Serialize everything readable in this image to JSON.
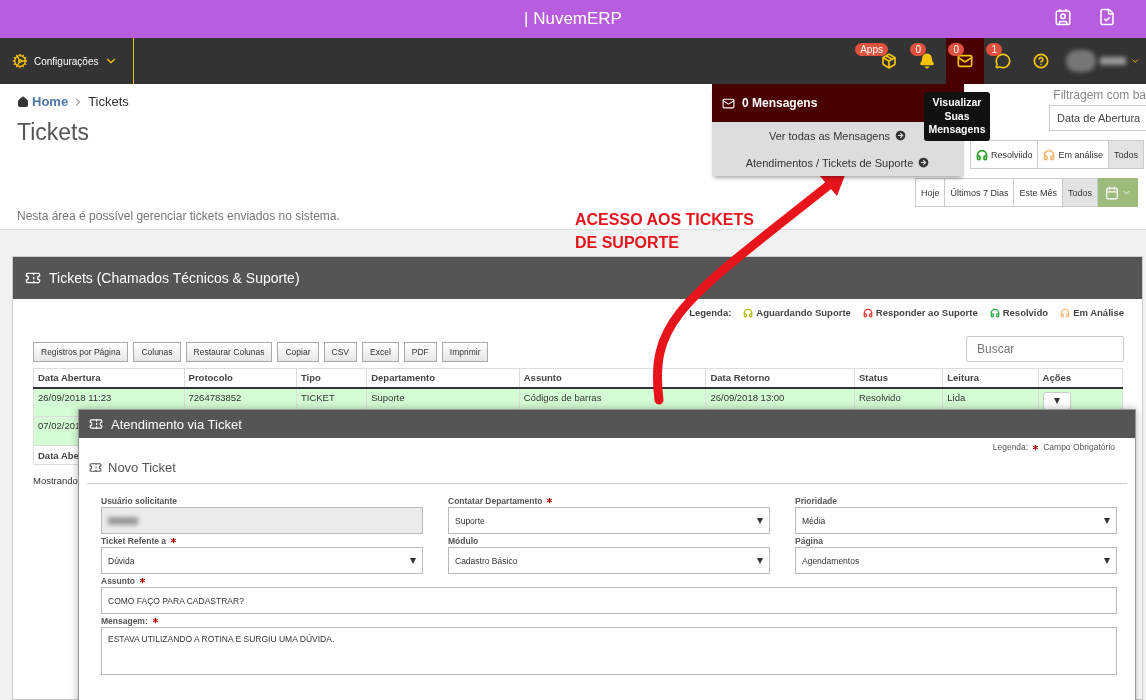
{
  "title_bar": {
    "title": "| NuvemERP"
  },
  "nav": {
    "menu": "Configurações",
    "items": [
      {
        "kind": "apps",
        "badge": "Apps",
        "selected": false
      },
      {
        "kind": "bell",
        "badge": "0",
        "selected": false
      },
      {
        "kind": "mail",
        "badge": "0",
        "selected": true
      },
      {
        "kind": "chat",
        "badge": "1",
        "selected": false
      },
      {
        "kind": "help",
        "selected": false
      },
      {
        "kind": "user",
        "selected": false
      }
    ]
  },
  "messages_menu": {
    "header": "0 Mensagens",
    "items": [
      "Ver todas as Mensagens",
      "Atendimentos / Tickets de Suporte"
    ]
  },
  "tooltip": "Visualizar Suas Mensagens",
  "breadcrumb": [
    "Home",
    "Tickets"
  ],
  "page_title": "Tickets",
  "description": "Nesta área é possível gerenciar tickets enviados no sistema.",
  "filter": {
    "label": "Filtragem com ba",
    "date_field": "Data de Abertura",
    "status_buttons": [
      {
        "label": "Resolviido",
        "color": "#2ca02c",
        "selected": false
      },
      {
        "label": "Em análise",
        "color": "#f5b971",
        "selected": false
      },
      {
        "label": "Todos",
        "selected": true
      }
    ],
    "period_buttons": [
      {
        "label": "Hoje",
        "selected": false
      },
      {
        "label": "Últimos 7 Dias",
        "selected": false
      },
      {
        "label": "Este Mês",
        "selected": false
      },
      {
        "label": "Todos",
        "selected": true
      }
    ]
  },
  "annotation": "ACESSO AOS TICKETS DE SUPORTE",
  "panel": {
    "title": "Tickets (Chamados Técnicos & Suporte)",
    "legend_label": "Legenda:",
    "legend": [
      {
        "label": "Aguardando Suporte",
        "color": "#b5b800"
      },
      {
        "label": "Responder ao Suporte",
        "color": "#d9342b"
      },
      {
        "label": "Resolvido",
        "color": "#1fa83a"
      },
      {
        "label": "Em Análise",
        "color": "#f5b971"
      }
    ],
    "toolbar": [
      "Registros por Página",
      "Colunas",
      "Restaurar Colunas",
      "Copiar",
      "CSV",
      "Excel",
      "PDF",
      "Imprimir"
    ],
    "search": {
      "placeholder": "Buscar"
    },
    "table": {
      "columns": [
        "Data Abertura",
        "Protocolo",
        "Tipo",
        "Departamento",
        "Assunto",
        "Data Retorno",
        "Status",
        "Leitura",
        "Ações"
      ],
      "rows": [
        {
          "cells": [
            "26/09/2018 11:23",
            "7264783852",
            "TICKET",
            "Suporte",
            "Códigos de barras",
            "26/09/2018 13:00",
            "Resolvido",
            "Lida"
          ],
          "actions": true
        },
        {
          "cells": [
            "07/02/201"
          ]
        }
      ],
      "footer_columns": [
        "Data Abe"
      ]
    },
    "info": "Mostrando"
  },
  "modal": {
    "title": "Atendimento via Ticket",
    "section": "Novo Ticket",
    "legend_label": "Legenda:",
    "legend_text": "Campo Obrigatório",
    "fields": [
      {
        "label": "Usuário solicitante",
        "kind": "text",
        "required": false,
        "disabled": true
      },
      {
        "label": "Contatar Departamento",
        "kind": "select",
        "required": true,
        "disabled": false,
        "value": "Suporte"
      },
      {
        "label": "Prioridade",
        "kind": "select",
        "required": false,
        "disabled": false,
        "value": "Média"
      },
      {
        "label": "Ticket Refente a",
        "kind": "select",
        "required": true,
        "disabled": false,
        "value": "Dúvida"
      },
      {
        "label": "Módulo",
        "kind": "select",
        "required": false,
        "disabled": false,
        "value": "Cadastro Básico"
      },
      {
        "label": "Página",
        "kind": "select",
        "required": false,
        "disabled": false,
        "value": "Agendamentos"
      },
      {
        "label": "Assunto",
        "kind": "text",
        "required": true,
        "disabled": false,
        "value": "COMO FAÇO PARA CADASTRAR?"
      },
      {
        "label": "Mensagem:",
        "kind": "textarea",
        "required": true,
        "disabled": false,
        "value": "ESTAVA UTILIZANDO A ROTINA E SURGIU UMA DÚVIDA."
      }
    ]
  }
}
